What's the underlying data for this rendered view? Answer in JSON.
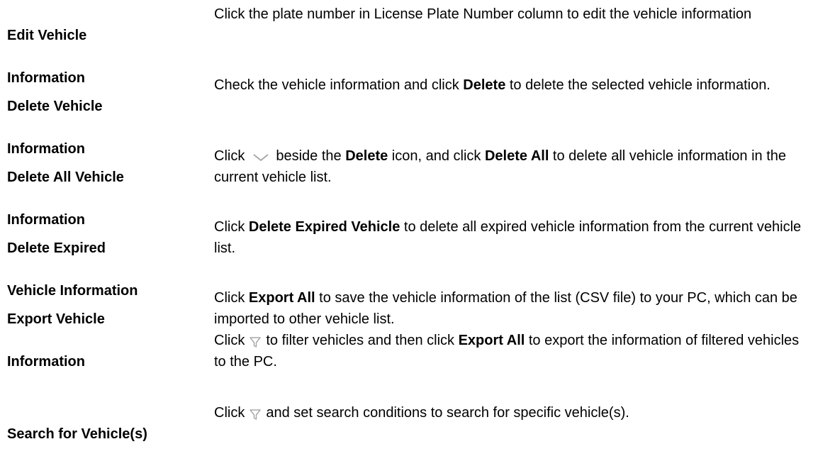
{
  "rows": [
    {
      "term_line1": "Edit Vehicle",
      "term_line2": "Information",
      "desc": "Click the plate number in License Plate Number column to edit the vehicle information"
    },
    {
      "term_line1": "Delete Vehicle",
      "term_line2": "Information",
      "desc_a": "Check the vehicle information and click ",
      "desc_b": "Delete",
      "desc_c": " to delete the selected vehicle information."
    },
    {
      "term_line1": "Delete All Vehicle",
      "term_line2": "Information",
      "desc_a": "Click",
      "desc_b": "beside the ",
      "desc_c": "Delete",
      "desc_d": " icon, and click ",
      "desc_e": "Delete All",
      "desc_f": " to delete all vehicle information in the current vehicle list.",
      "icon": "chevron-down-icon"
    },
    {
      "term_line1": "Delete Expired",
      "term_line2": "Vehicle Information",
      "desc_a": "Click ",
      "desc_b": "Delete Expired Vehicle",
      "desc_c": " to delete all expired vehicle information from the current vehicle list."
    },
    {
      "term_line1": "Export Vehicle",
      "term_line2": "Information",
      "p1_a": "Click ",
      "p1_b": "Export All",
      "p1_c": " to save the vehicle information of the list (CSV file) to your PC, which can be imported to other vehicle list.",
      "p2_a": "Click",
      "p2_b": "to filter vehicles and then click ",
      "p2_c": "Export All",
      "p2_d": " to export the information of filtered vehicles to the PC.",
      "icon": "filter-icon"
    },
    {
      "term_line1": "Search for Vehicle(s)",
      "desc_a": "Click",
      "desc_b": "and set search conditions to search for specific vehicle(s).",
      "icon": "filter-icon"
    }
  ],
  "colors": {
    "text": "#000000",
    "icon": "#a9a9a9"
  }
}
